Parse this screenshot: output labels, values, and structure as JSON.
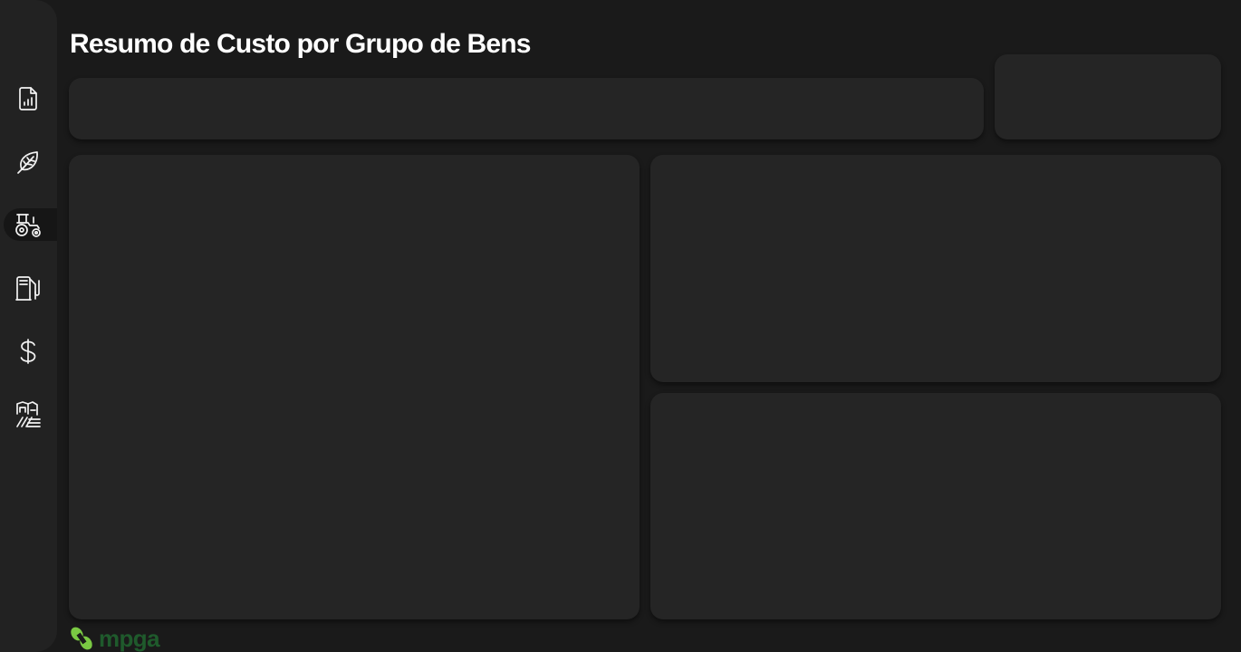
{
  "page_title": "Resumo de Custo por Grupo de Bens",
  "sidebar": {
    "items": [
      {
        "icon": "report-document-icon",
        "active": false
      },
      {
        "icon": "leaf-icon",
        "active": false
      },
      {
        "icon": "tractor-icon",
        "active": true
      },
      {
        "icon": "fuel-pump-icon",
        "active": false
      },
      {
        "icon": "dollar-icon",
        "active": false
      },
      {
        "icon": "farm-barn-icon",
        "active": false
      }
    ]
  },
  "logo": {
    "text": "mpga",
    "mark_color": "#7ac943",
    "text_color": "#1f5a2c"
  },
  "colors": {
    "background": "#1a1a1a",
    "sidebar": "#222222",
    "card": "#252525",
    "active_nav": "#161616"
  }
}
